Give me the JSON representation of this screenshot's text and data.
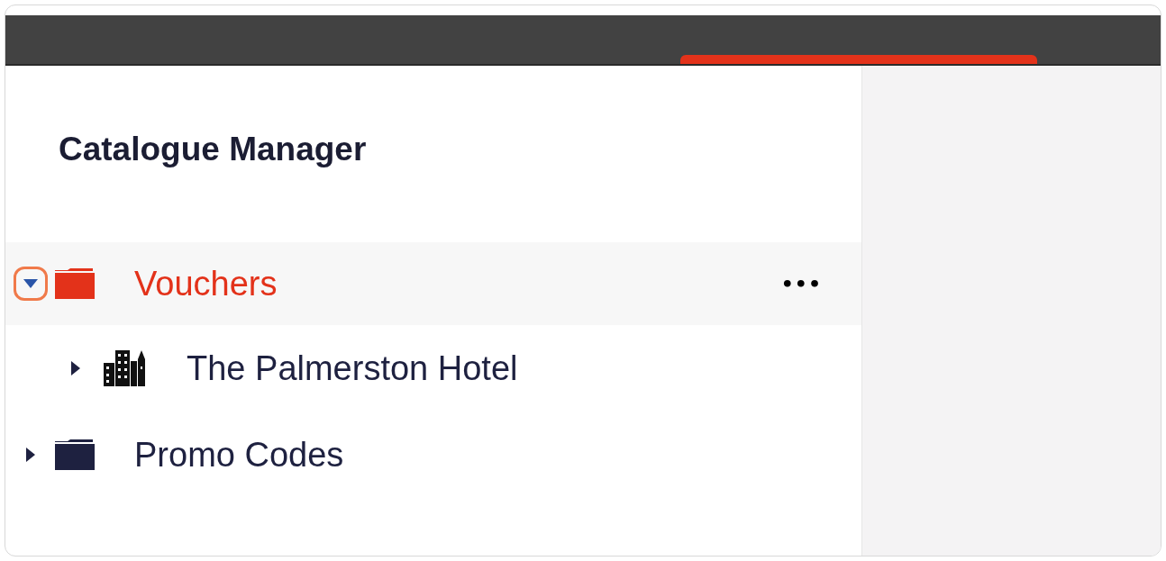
{
  "panel_title": "Catalogue Manager",
  "tree": [
    {
      "label": "Vouchers",
      "kind": "folder",
      "expanded": true,
      "selected": true,
      "highlighted": true,
      "menu": "•••",
      "children": [
        {
          "label": "The Palmerston Hotel",
          "kind": "building",
          "expanded": false,
          "selected": false,
          "highlighted": false
        }
      ]
    },
    {
      "label": "Promo Codes",
      "kind": "folder",
      "expanded": false,
      "selected": false,
      "highlighted": false
    }
  ]
}
